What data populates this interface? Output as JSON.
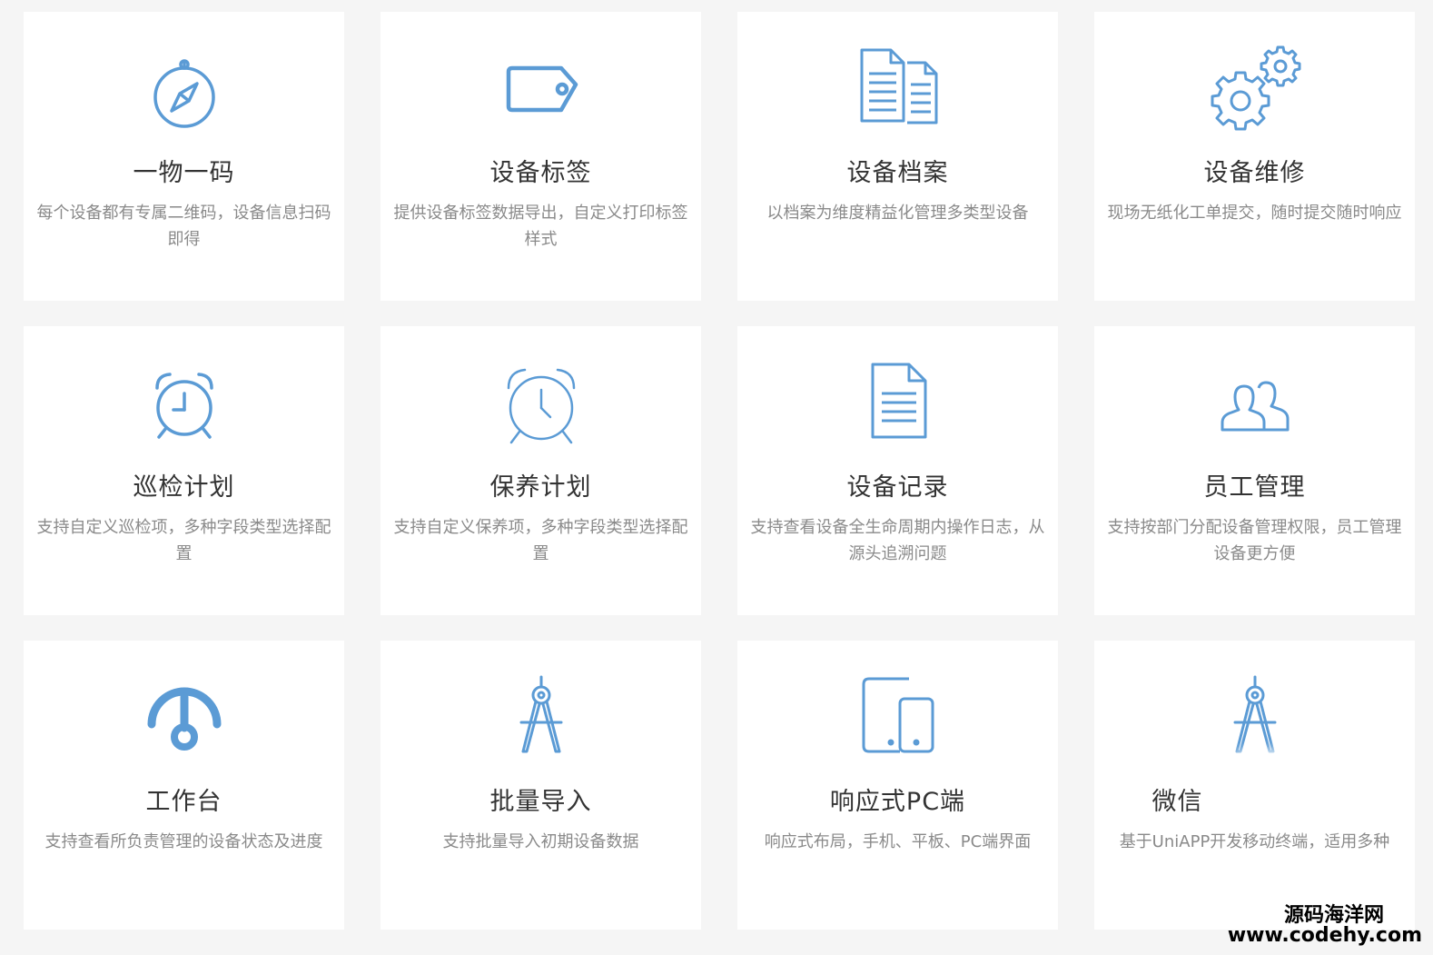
{
  "colors": {
    "icon": "#5b9bd5",
    "title": "#333333",
    "desc": "#8a8a8a",
    "card": "#ffffff",
    "page": "#f5f5f5"
  },
  "cards": [
    {
      "icon": "compass-icon",
      "title": "一物一码",
      "desc": "每个设备都有专属二维码，设备信息扫码即得"
    },
    {
      "icon": "tag-icon",
      "title": "设备标签",
      "desc": "提供设备标签数据导出，自定义打印标签样式"
    },
    {
      "icon": "documents-icon",
      "title": "设备档案",
      "desc": "以档案为维度精益化管理多类型设备"
    },
    {
      "icon": "gears-icon",
      "title": "设备维修",
      "desc": "现场无纸化工单提交，随时提交随时响应"
    },
    {
      "icon": "alarm-clock-icon",
      "title": "巡检计划",
      "desc": "支持自定义巡检项，多种字段类型选择配置"
    },
    {
      "icon": "alarm-clock-outline-icon",
      "title": "保养计划",
      "desc": "支持自定义保养项，多种字段类型选择配置"
    },
    {
      "icon": "document-icon",
      "title": "设备记录",
      "desc": "支持查看设备全生命周期内操作日志，从源头追溯问题"
    },
    {
      "icon": "users-icon",
      "title": "员工管理",
      "desc": "支持按部门分配设备管理权限，员工管理设备更方便"
    },
    {
      "icon": "dashboard-icon",
      "title": "工作台",
      "desc": "支持查看所负责管理的设备状态及进度"
    },
    {
      "icon": "drafting-compass-icon",
      "title": "批量导入",
      "desc": "支持批量导入初期设备数据"
    },
    {
      "icon": "devices-icon",
      "title": "响应式PC端",
      "desc": "响应式布局，手机、平板、PC端界面"
    },
    {
      "icon": "drafting-compass-icon",
      "title": "微信",
      "desc": "基于UniAPP开发移动终端，适用多种"
    }
  ],
  "watermark": {
    "line1": "源码海洋网",
    "line2": "www.codehy.com"
  }
}
